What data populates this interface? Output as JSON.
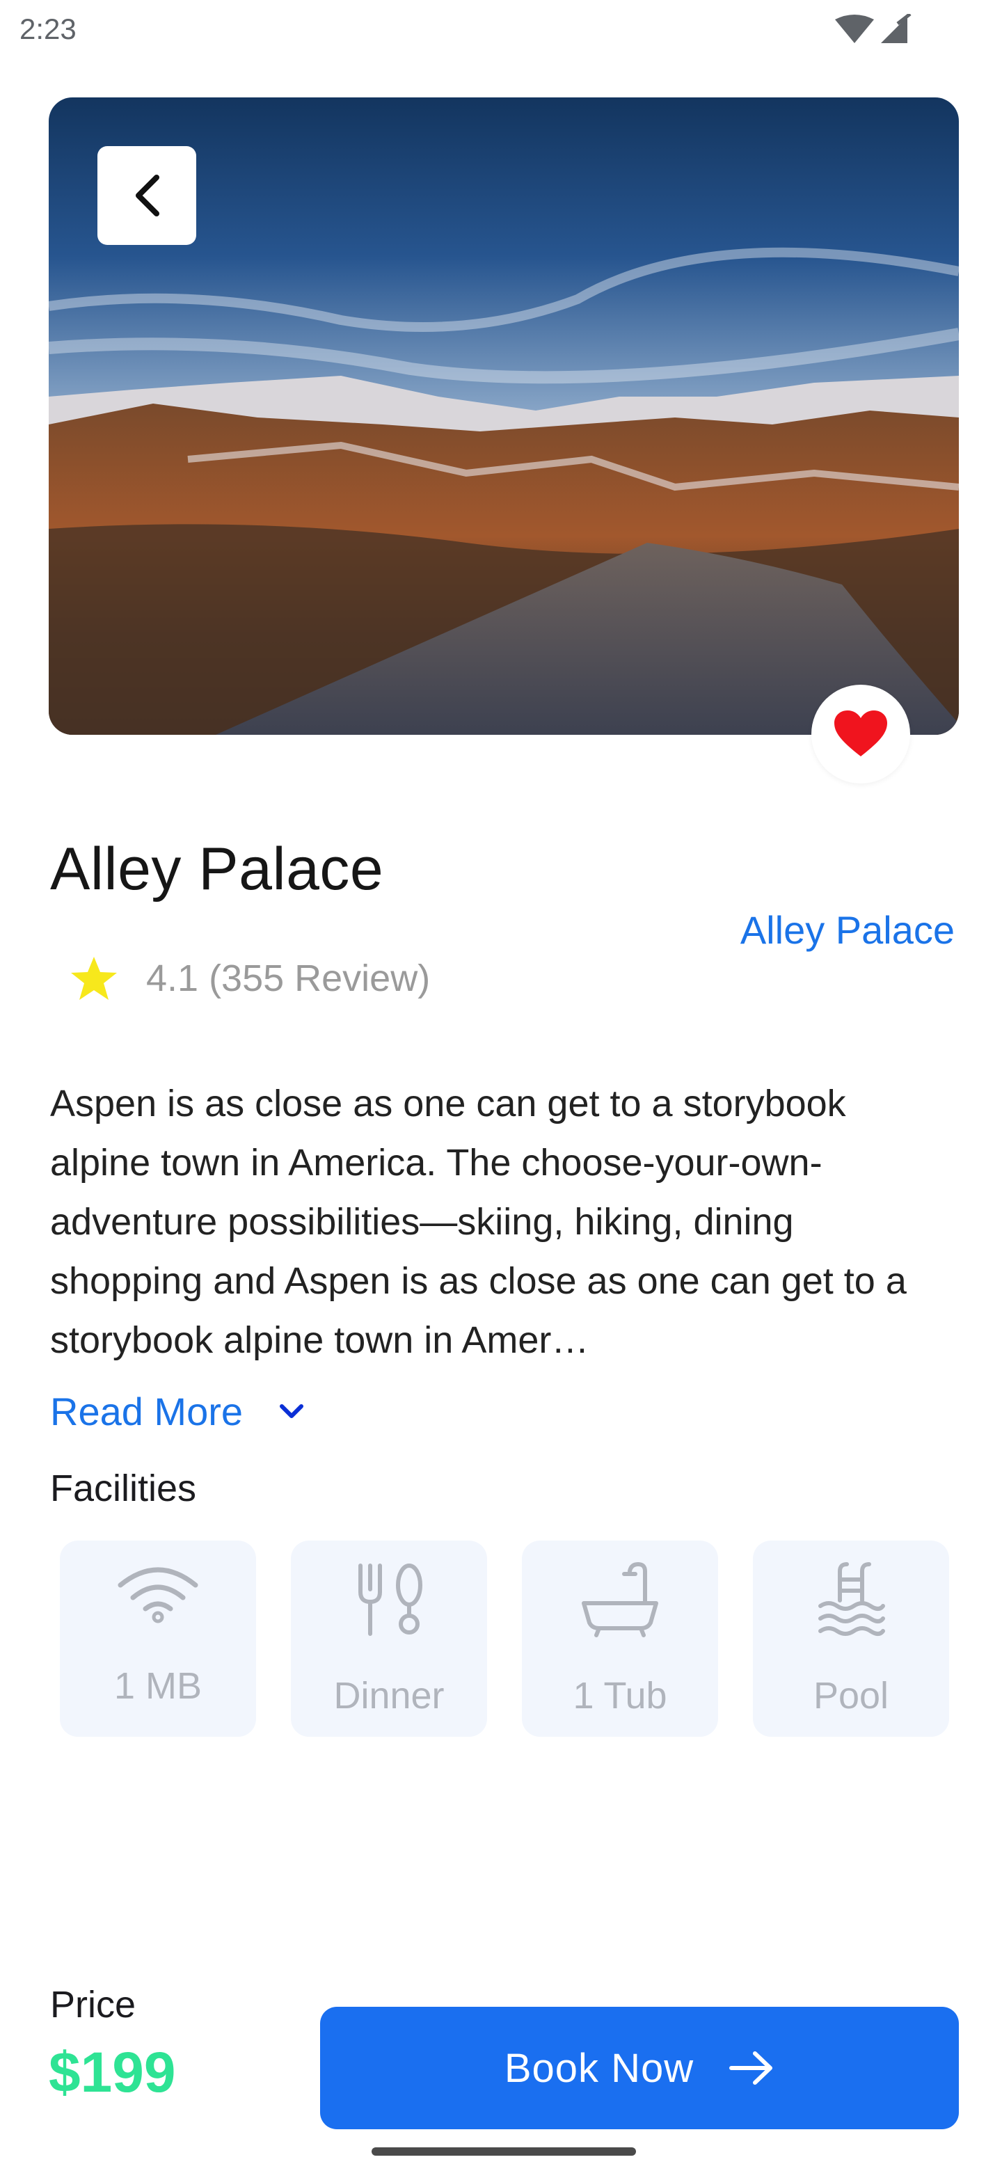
{
  "status_bar": {
    "time": "2:23"
  },
  "hero": {
    "image_description_icon": "landscape-photo"
  },
  "header": {
    "title": "Alley Palace",
    "location": "Alley Palace"
  },
  "rating": {
    "text": "4.1 (355 Review)",
    "value": 4.1,
    "reviews": 355
  },
  "description": {
    "text": "Aspen is as close as one can get to a storybook alpine town in America. The choose-your-own-adventure possibilities—skiing, hiking, dining shopping and Aspen is as close as one can get to a storybook alpine town in Amer…",
    "read_more": "Read More"
  },
  "facilities": {
    "heading": "Facilities",
    "items": [
      {
        "label": "1 MB",
        "icon": "wifi-icon"
      },
      {
        "label": "Dinner",
        "icon": "dinner-icon"
      },
      {
        "label": "1 Tub",
        "icon": "bathtub-icon"
      },
      {
        "label": "Pool",
        "icon": "pool-icon"
      }
    ]
  },
  "footer": {
    "price_label": "Price",
    "price": "$199",
    "book_label": "Book Now"
  },
  "colors": {
    "accent": "#1a73e8",
    "button": "#1a6ff0",
    "price": "#2ee394",
    "favorite": "#f0141e",
    "star": "#f7e81c"
  }
}
